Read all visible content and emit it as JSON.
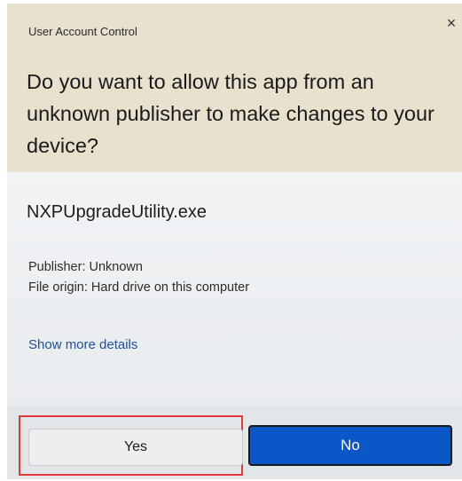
{
  "dialog": {
    "title": "User Account Control",
    "close_icon": "close-icon",
    "close_glyph": "×",
    "question": "Do you want to allow this app from an unknown publisher to make changes to your device?"
  },
  "app": {
    "name": "NXPUpgradeUtility.exe",
    "publisher": "Publisher: Unknown",
    "file_origin": "File origin: Hard drive on this computer",
    "show_more": "Show more details"
  },
  "buttons": {
    "yes": "Yes",
    "no": "No"
  },
  "colors": {
    "header_background": "#e7e1cd",
    "primary_button": "#0a57c8",
    "link": "#1f4f9e",
    "highlight": "#e3393b"
  }
}
